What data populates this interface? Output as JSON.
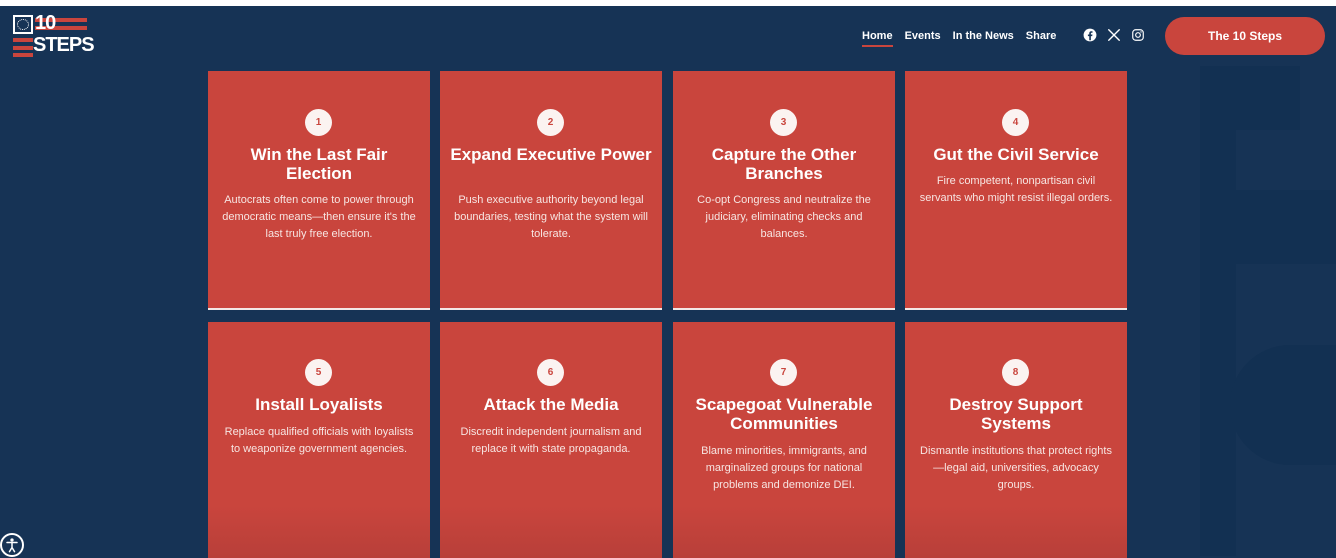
{
  "header": {
    "logo": {
      "line1": "10",
      "line2": "STEPS"
    },
    "nav": [
      {
        "label": "Home",
        "active": true
      },
      {
        "label": "Events",
        "active": false
      },
      {
        "label": "In the News",
        "active": false
      },
      {
        "label": "Share",
        "active": false
      }
    ],
    "socials": [
      "facebook-icon",
      "x-icon",
      "instagram-icon"
    ],
    "cta_label": "The 10 Steps"
  },
  "colors": {
    "background": "#163355",
    "accent": "#c9453d",
    "white": "#ffffff"
  },
  "cards": [
    {
      "number": "1",
      "title": "Win the Last Fair Election",
      "description": "Autocrats often come to power through democratic means—then ensure it's the last truly free election."
    },
    {
      "number": "2",
      "title": "Expand Executive Power",
      "description": "Push executive authority beyond legal boundaries, testing what the system will tolerate."
    },
    {
      "number": "3",
      "title": "Capture the Other Branches",
      "description": "Co-opt Congress and neutralize the judiciary, eliminating checks and balances."
    },
    {
      "number": "4",
      "title": "Gut the Civil Service",
      "description": "Fire competent, nonpartisan civil servants who might resist illegal orders."
    },
    {
      "number": "5",
      "title": "Install Loyalists",
      "description": "Replace qualified officials with loyalists to weaponize government agencies."
    },
    {
      "number": "6",
      "title": "Attack the Media",
      "description": "Discredit independent journalism and replace it with state propaganda."
    },
    {
      "number": "7",
      "title": "Scapegoat Vulnerable Communities",
      "description": "Blame minorities, immigrants, and marginalized groups for national problems and demonize DEI."
    },
    {
      "number": "8",
      "title": "Destroy Support Systems",
      "description": "Dismantle institutions that protect rights—legal aid, universities, advocacy groups."
    }
  ]
}
